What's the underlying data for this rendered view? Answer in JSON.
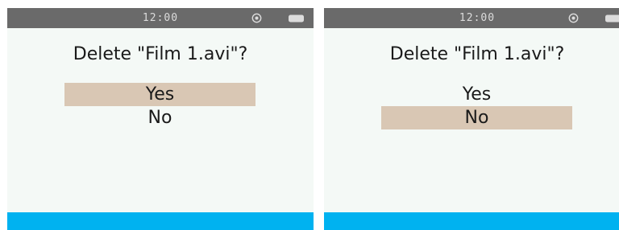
{
  "colors": {
    "status_bar": "#6a6a6a",
    "screen_bg": "#f4f9f6",
    "selection": "#d9c7b4",
    "bottom_bar": "#00b2f0"
  },
  "screens": [
    {
      "status": {
        "time": "12:00",
        "icons": [
          "target-icon",
          "battery-icon"
        ]
      },
      "prompt": "Delete \"Film 1.avi\"?",
      "options": [
        {
          "label": "Yes",
          "selected": true
        },
        {
          "label": "No",
          "selected": false
        }
      ]
    },
    {
      "status": {
        "time": "12:00",
        "icons": [
          "target-icon",
          "battery-icon"
        ]
      },
      "prompt": "Delete \"Film 1.avi\"?",
      "options": [
        {
          "label": "Yes",
          "selected": false
        },
        {
          "label": "No",
          "selected": true
        }
      ]
    }
  ]
}
